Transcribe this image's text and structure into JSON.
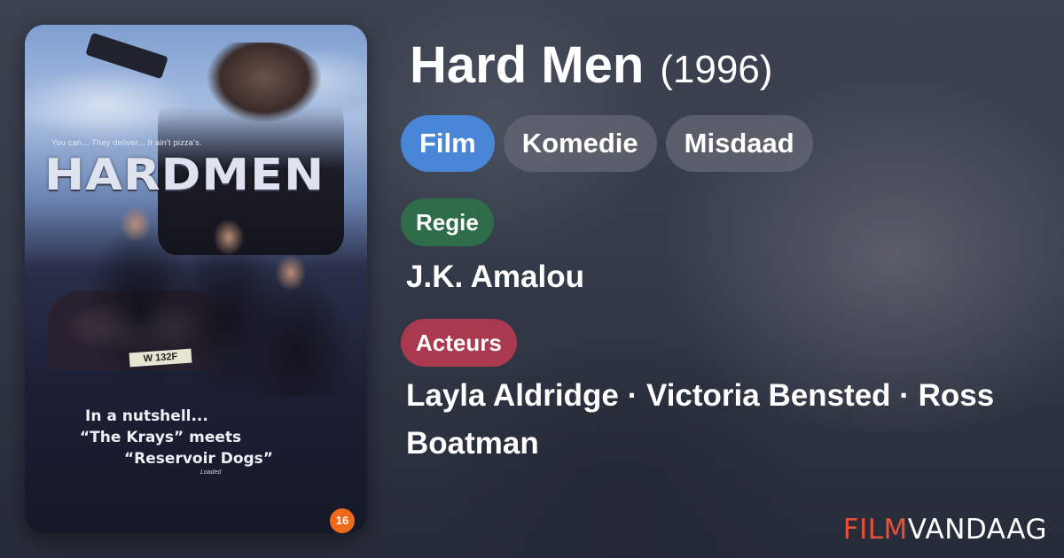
{
  "colors": {
    "film_pill": "#4a86d8",
    "genre_pill": "#5f6470",
    "regie_label": "#2f6c4a",
    "acteurs_label": "#a8394f",
    "brand_accent": "#e8503a",
    "rating_badge": "#ec6a1a"
  },
  "poster": {
    "tagline": "You can... They deliver... It ain't pizza's.",
    "title": "HARDMEN",
    "license_plate": "W 132F",
    "quote_lines": [
      "In a nutshell...",
      "“The Krays” meets",
      "“Reservoir Dogs”"
    ],
    "quote_source": "Loaded",
    "rating": "16"
  },
  "movie": {
    "title": "Hard Men",
    "year": "(1996)",
    "genres": [
      "Film",
      "Komedie",
      "Misdaad"
    ],
    "director_label": "Regie",
    "director": "J.K. Amalou",
    "actors_label": "Acteurs",
    "actors": "Layla Aldridge · Victoria Bensted · Ross Boatman"
  },
  "brand": {
    "part1": "FILM",
    "part2": "VANDAAG"
  }
}
